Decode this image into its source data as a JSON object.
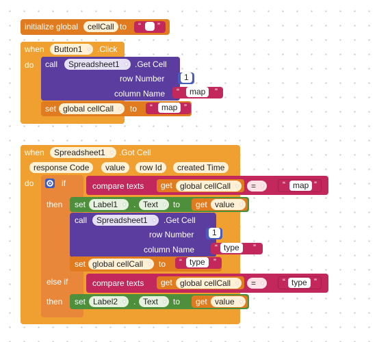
{
  "init": {
    "initialize_global": "initialize global",
    "var_name": "cellCall",
    "to": "to",
    "quote_left": "“",
    "quote_right": "”"
  },
  "event1": {
    "when": "when",
    "component": "Button1",
    "event": ".Click",
    "do": "do",
    "call": "call",
    "call_component": "Spreadsheet1",
    "method": ".Get Cell",
    "row_number_label": "row Number",
    "row_number_value": "1",
    "column_name_label": "column Name",
    "column_name_value": "map",
    "set": "set",
    "set_target": "global cellCall",
    "set_to": "to",
    "set_value": "map"
  },
  "event2": {
    "when": "when",
    "component": "Spreadsheet1",
    "event": ".Got Cell",
    "params": [
      "response Code",
      "value",
      "row Id",
      "created Time"
    ],
    "do": "do",
    "if": "if",
    "then": "then",
    "else_if": "else if",
    "then2": "then",
    "compare1": {
      "label": "compare texts",
      "get": "get",
      "var": "global cellCall",
      "op": "=",
      "value": "map"
    },
    "set_label1": {
      "set": "set",
      "component": "Label1",
      "dot": ".",
      "property": "Text",
      "to": "to",
      "get": "get",
      "var": "value"
    },
    "call": {
      "call": "call",
      "component": "Spreadsheet1",
      "method": ".Get Cell",
      "row_number_label": "row Number",
      "row_number_value": "1",
      "column_name_label": "column Name",
      "column_name_value": "type"
    },
    "set_global": {
      "set": "set",
      "var": "global cellCall",
      "to": "to",
      "value": "type"
    },
    "compare2": {
      "label": "compare texts",
      "get": "get",
      "var": "global cellCall",
      "op": "=",
      "value": "type"
    },
    "set_label2": {
      "set": "set",
      "component": "Label2",
      "dot": ".",
      "property": "Text",
      "to": "to",
      "get": "get",
      "var": "value"
    }
  },
  "colors": {
    "event_orange": "#f0a030",
    "variable_orange": "#e07b1f",
    "procedure_purple": "#5a3d9e",
    "text_magenta": "#c2285c",
    "component_green": "#4d8f3a",
    "math_blue": "#4a5cc0"
  }
}
